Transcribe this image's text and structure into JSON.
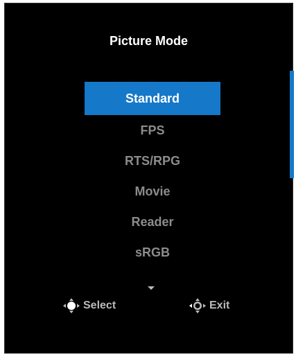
{
  "osd": {
    "title": "Picture Mode",
    "menu_items": [
      {
        "label": "Standard",
        "selected": true
      },
      {
        "label": "FPS",
        "selected": false
      },
      {
        "label": "RTS/RPG",
        "selected": false
      },
      {
        "label": "Movie",
        "selected": false
      },
      {
        "label": "Reader",
        "selected": false
      },
      {
        "label": "sRGB",
        "selected": false
      }
    ],
    "hints": {
      "select_label": "Select",
      "exit_label": "Exit"
    },
    "colors": {
      "highlight": "#1578c8",
      "background": "#000000",
      "text_active": "#ffffff",
      "text_inactive": "#8c8c8c"
    },
    "icons": {
      "select": "joystick-press-icon",
      "exit": "joystick-left-icon",
      "more": "chevron-down-icon"
    }
  }
}
